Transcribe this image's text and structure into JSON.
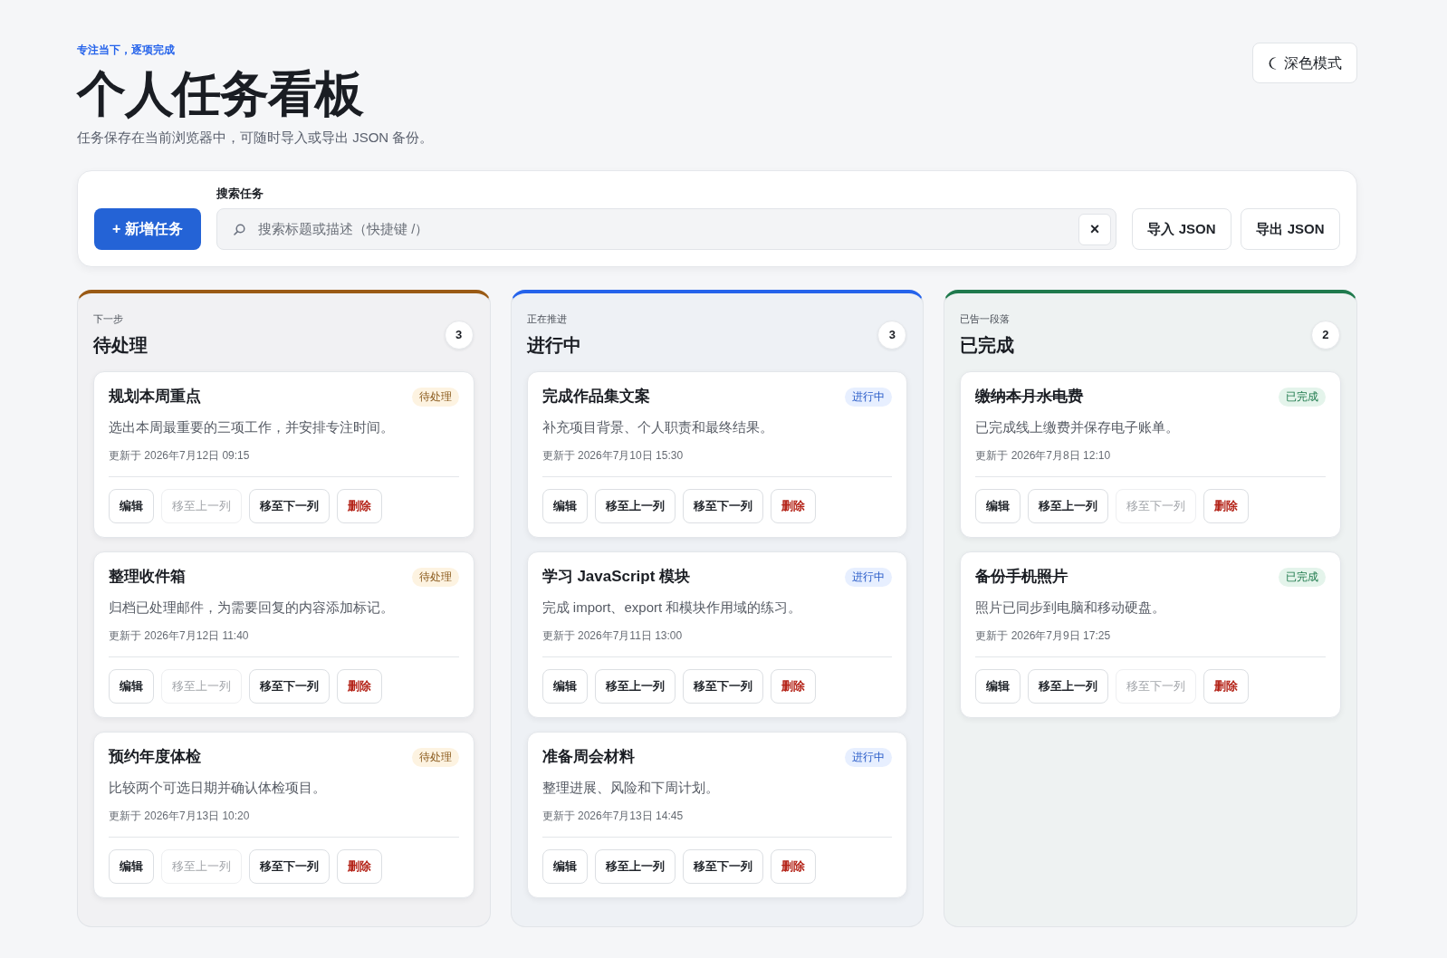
{
  "header": {
    "eyebrow": "专注当下，逐项完成",
    "title": "个人任务看板",
    "subtitle": "任务保存在当前浏览器中，可随时导入或导出 JSON 备份。",
    "theme_button": "深色模式"
  },
  "toolbar": {
    "add_button": "+ 新增任务",
    "search": {
      "label": "搜索任务",
      "placeholder": "搜索标题或描述（快捷键 /）",
      "clear_button": "×"
    },
    "buttons": [
      "导入 JSON",
      "导出 JSON"
    ]
  },
  "columns": [
    {
      "kind": "pending",
      "color": "#9a5a14",
      "eyebrow": "下一步",
      "title": "待处理",
      "count": "3",
      "tasks": [
        {
          "title": "规划本周重点",
          "badge": "待处理",
          "completed": false,
          "description": "选出本周最重要的三项工作，并安排专注时间。",
          "updated": "更新于 2026年7月12日 09:15",
          "actions": [
            {
              "kind": "edit",
              "label": "编辑",
              "disabled": false
            },
            {
              "kind": "move_prev",
              "label": "移至上一列",
              "disabled": true
            },
            {
              "kind": "move_next",
              "label": "移至下一列",
              "disabled": false
            },
            {
              "kind": "delete",
              "label": "删除",
              "disabled": false
            }
          ]
        },
        {
          "title": "整理收件箱",
          "badge": "待处理",
          "completed": false,
          "description": "归档已处理邮件，为需要回复的内容添加标记。",
          "updated": "更新于 2026年7月12日 11:40",
          "actions": [
            {
              "kind": "edit",
              "label": "编辑",
              "disabled": false
            },
            {
              "kind": "move_prev",
              "label": "移至上一列",
              "disabled": true
            },
            {
              "kind": "move_next",
              "label": "移至下一列",
              "disabled": false
            },
            {
              "kind": "delete",
              "label": "删除",
              "disabled": false
            }
          ]
        },
        {
          "title": "预约年度体检",
          "badge": "待处理",
          "completed": false,
          "description": "比较两个可选日期并确认体检项目。",
          "updated": "更新于 2026年7月13日 10:20",
          "actions": [
            {
              "kind": "edit",
              "label": "编辑",
              "disabled": false
            },
            {
              "kind": "move_prev",
              "label": "移至上一列",
              "disabled": true
            },
            {
              "kind": "move_next",
              "label": "移至下一列",
              "disabled": false
            },
            {
              "kind": "delete",
              "label": "删除",
              "disabled": false
            }
          ]
        }
      ]
    },
    {
      "kind": "active",
      "color": "#2563eb",
      "eyebrow": "正在推进",
      "title": "进行中",
      "count": "3",
      "tasks": [
        {
          "title": "完成作品集文案",
          "badge": "进行中",
          "completed": false,
          "description": "补充项目背景、个人职责和最终结果。",
          "updated": "更新于 2026年7月10日 15:30",
          "actions": [
            {
              "kind": "edit",
              "label": "编辑",
              "disabled": false
            },
            {
              "kind": "move_prev",
              "label": "移至上一列",
              "disabled": false
            },
            {
              "kind": "move_next",
              "label": "移至下一列",
              "disabled": false
            },
            {
              "kind": "delete",
              "label": "删除",
              "disabled": false
            }
          ]
        },
        {
          "title": "学习 JavaScript 模块",
          "badge": "进行中",
          "completed": false,
          "description": "完成 import、export 和模块作用域的练习。",
          "updated": "更新于 2026年7月11日 13:00",
          "actions": [
            {
              "kind": "edit",
              "label": "编辑",
              "disabled": false
            },
            {
              "kind": "move_prev",
              "label": "移至上一列",
              "disabled": false
            },
            {
              "kind": "move_next",
              "label": "移至下一列",
              "disabled": false
            },
            {
              "kind": "delete",
              "label": "删除",
              "disabled": false
            }
          ]
        },
        {
          "title": "准备周会材料",
          "badge": "进行中",
          "completed": false,
          "description": "整理进展、风险和下周计划。",
          "updated": "更新于 2026年7月13日 14:45",
          "actions": [
            {
              "kind": "edit",
              "label": "编辑",
              "disabled": false
            },
            {
              "kind": "move_prev",
              "label": "移至上一列",
              "disabled": false
            },
            {
              "kind": "move_next",
              "label": "移至下一列",
              "disabled": false
            },
            {
              "kind": "delete",
              "label": "删除",
              "disabled": false
            }
          ]
        }
      ]
    },
    {
      "kind": "done",
      "color": "#1f7a4d",
      "eyebrow": "已告一段落",
      "title": "已完成",
      "count": "2",
      "tasks": [
        {
          "title": "缴纳本月水电费",
          "badge": "已完成",
          "completed": true,
          "description": "已完成线上缴费并保存电子账单。",
          "updated": "更新于 2026年7月8日 12:10",
          "actions": [
            {
              "kind": "edit",
              "label": "编辑",
              "disabled": false
            },
            {
              "kind": "move_prev",
              "label": "移至上一列",
              "disabled": false
            },
            {
              "kind": "move_next",
              "label": "移至下一列",
              "disabled": true
            },
            {
              "kind": "delete",
              "label": "删除",
              "disabled": false
            }
          ]
        },
        {
          "title": "备份手机照片",
          "badge": "已完成",
          "completed": true,
          "description": "照片已同步到电脑和移动硬盘。",
          "updated": "更新于 2026年7月9日 17:25",
          "actions": [
            {
              "kind": "edit",
              "label": "编辑",
              "disabled": false
            },
            {
              "kind": "move_prev",
              "label": "移至上一列",
              "disabled": false
            },
            {
              "kind": "move_next",
              "label": "移至下一列",
              "disabled": true
            },
            {
              "kind": "delete",
              "label": "删除",
              "disabled": false
            }
          ]
        }
      ]
    }
  ]
}
